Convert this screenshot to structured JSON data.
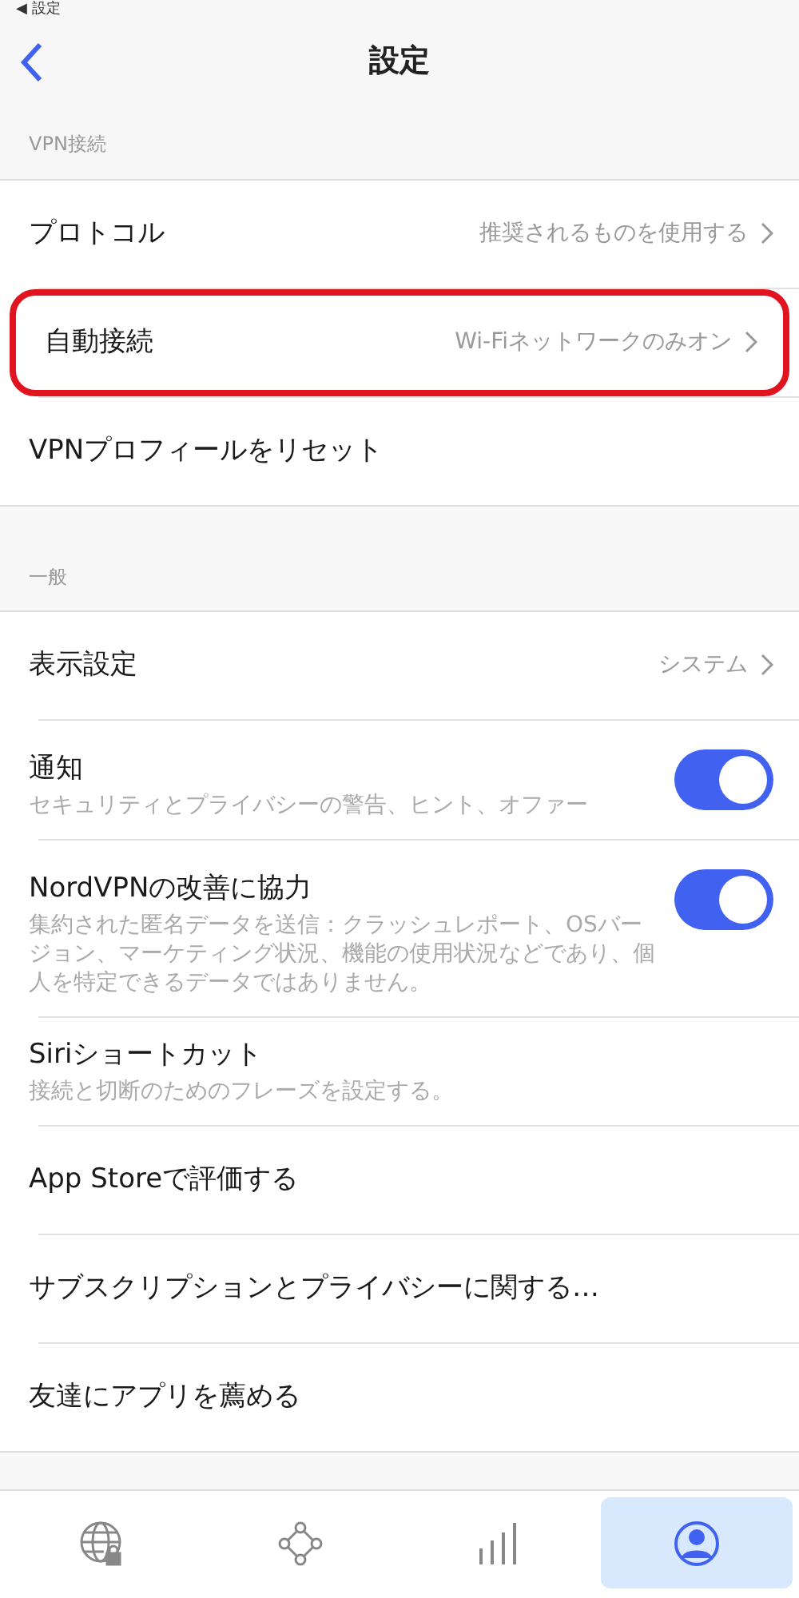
{
  "status_back": "◀ 設定",
  "header": {
    "title": "設定"
  },
  "sections": [
    {
      "label": "VPN接続",
      "rows": [
        {
          "kind": "link",
          "title": "プロトコル",
          "value": "推奨されるものを使用する",
          "highlighted": false
        },
        {
          "kind": "link",
          "title": "自動接続",
          "value": "Wi-Fiネットワークのみオン",
          "highlighted": true
        },
        {
          "kind": "plain",
          "title": "VPNプロフィールをリセット",
          "highlighted": false
        }
      ]
    },
    {
      "label": "一般",
      "rows": [
        {
          "kind": "link",
          "title": "表示設定",
          "value": "システム",
          "highlighted": false
        },
        {
          "kind": "toggle",
          "title": "通知",
          "subtitle": "セキュリティとプライバシーの警告、ヒント、オファー",
          "on": true,
          "highlighted": false
        },
        {
          "kind": "toggle",
          "title": "NordVPNの改善に協力",
          "subtitle": "集約された匿名データを送信：クラッシュレポート、OSバージョン、マーケティング状況、機能の使用状況などであり、個人を特定できるデータではありません。",
          "on": true,
          "highlighted": false
        },
        {
          "kind": "plain",
          "title": "Siriショートカット",
          "subtitle": "接続と切断のためのフレーズを設定する。",
          "highlighted": false
        },
        {
          "kind": "plain",
          "title": "App Storeで評価する",
          "highlighted": false
        },
        {
          "kind": "plain",
          "title": "サブスクリプションとプライバシーに関する…",
          "highlighted": false
        },
        {
          "kind": "plain",
          "title": "友達にアプリを薦める",
          "highlighted": false
        }
      ]
    }
  ],
  "tabs": [
    {
      "kind": "globe",
      "selected": false
    },
    {
      "kind": "nodes",
      "selected": false
    },
    {
      "kind": "bars",
      "selected": false
    },
    {
      "kind": "profile",
      "selected": true
    }
  ]
}
